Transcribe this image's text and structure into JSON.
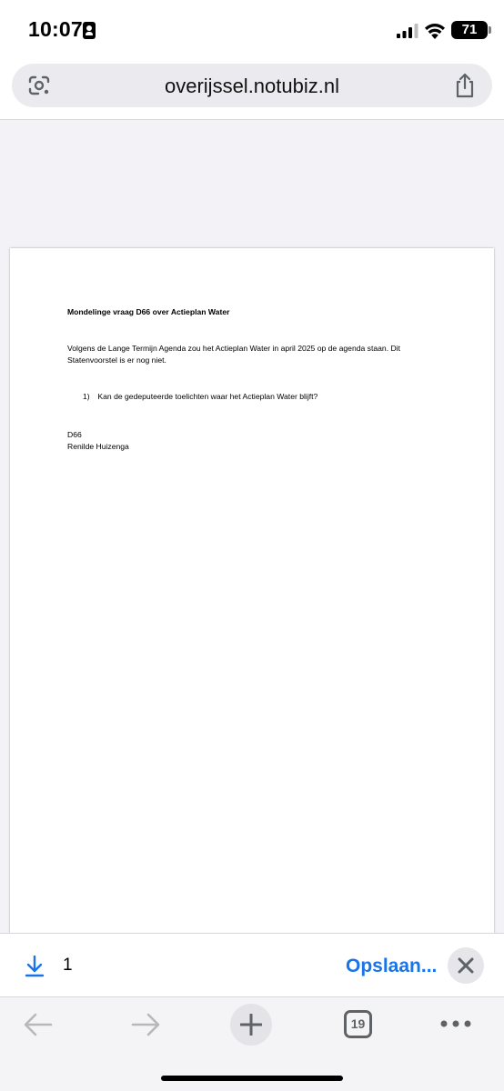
{
  "status_bar": {
    "time": "10:07",
    "battery": "71",
    "icons": [
      "id-card-icon",
      "signal-icon",
      "wifi-icon",
      "battery-icon"
    ]
  },
  "address_bar": {
    "url": "overijssel.notubiz.nl",
    "icons": [
      "google-lens-icon",
      "share-icon"
    ]
  },
  "document": {
    "title": "Mondelinge vraag D66 over Actieplan Water",
    "paragraph": "Volgens de Lange Termijn Agenda zou het Actieplan Water in april 2025 op de agenda staan. Dit Statenvoorstel is er nog niet.",
    "question_number": "1)",
    "question_text": "Kan de gedeputeerde toelichten waar het Actieplan Water blijft?",
    "signature_party": "D66",
    "signature_name": "Renilde Huizenga"
  },
  "download_bar": {
    "count": "1",
    "save_label": "Opslaan...",
    "icons": [
      "download-icon",
      "close-icon"
    ]
  },
  "toolbar": {
    "tab_count": "19",
    "icons": [
      "back-arrow-icon",
      "forward-arrow-icon",
      "plus-icon",
      "tabs-icon",
      "more-icon"
    ]
  },
  "colors": {
    "accent": "#1a73e8",
    "page_background": "#f2f2f7",
    "icon_gray": "#5f6368"
  }
}
